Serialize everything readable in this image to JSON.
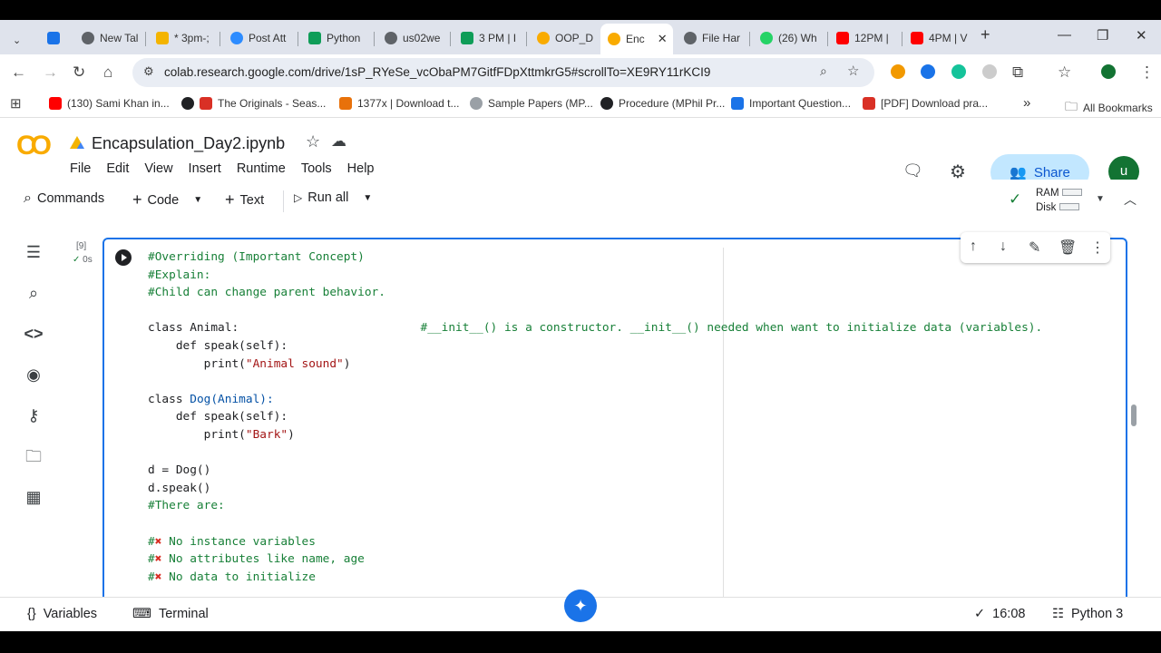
{
  "browser": {
    "tabs": [
      {
        "label": "New Tal",
        "color": "#5f6368"
      },
      {
        "label": "* 3pm-;",
        "color": "#f4b400"
      },
      {
        "label": "Post Att",
        "color": "#2d8cff"
      },
      {
        "label": "Python",
        "color": "#0f9d58"
      },
      {
        "label": "us02we",
        "color": "#5f6368"
      },
      {
        "label": "3 PM | I",
        "color": "#0f9d58"
      },
      {
        "label": "OOP_D",
        "color": "#f9ab00"
      },
      {
        "label": "Enc",
        "color": "#f9ab00"
      },
      {
        "label": "File Har",
        "color": "#5f6368"
      },
      {
        "label": "(26) Wh",
        "color": "#25d366"
      },
      {
        "label": "12PM |",
        "color": "#ff0000"
      },
      {
        "label": "4PM | V",
        "color": "#ff0000"
      }
    ],
    "url": "colab.research.google.com/drive/1sP_RYeSe_vcObaPM7GitfFDpXttmkrG5#scrollTo=XE9RY11rKCI9",
    "bookmarks": [
      "(130) Sami Khan in...",
      "The Originals - Seas...",
      "1377x | Download t...",
      "Sample Papers (MP...",
      "Procedure (MPhil Pr...",
      "Important Question...",
      "[PDF] Download pra..."
    ],
    "all_bookmarks": "All Bookmarks"
  },
  "colab": {
    "logo": "CO",
    "title": "Encapsulation_Day2.ipynb",
    "menu": [
      "File",
      "Edit",
      "View",
      "Insert",
      "Runtime",
      "Tools",
      "Help"
    ],
    "share": "Share",
    "avatar_letter": "u",
    "toolbar": {
      "commands": "Commands",
      "code": "Code",
      "text": "Text",
      "run_all": "Run all",
      "ram": "RAM",
      "disk": "Disk"
    },
    "cell": {
      "exec_count": "[9]",
      "exec_time": "0s",
      "lines": {
        "l1": "#Overriding (Important Concept)",
        "l2": "#Explain:",
        "l3": "#Child can change parent behavior.",
        "l5a": "class Animal:",
        "l5b": "#__init__() is a constructor. __init__() needed when want to initialize data (variables).",
        "l6": "    def speak(self):",
        "l7a": "        print(",
        "l7b": "\"Animal sound\"",
        "l7c": ")",
        "l9a": "class ",
        "l9b": "Dog(Animal):",
        "l10": "    def speak(self):",
        "l11a": "        print(",
        "l11b": "\"Bark\"",
        "l11c": ")",
        "l13": "d = Dog()",
        "l14": "d.speak()",
        "l15": "#There are:",
        "l17": "No instance variables",
        "l18": "No attributes like name, age",
        "l19": "No data to initialize"
      }
    },
    "status": {
      "variables": "Variables",
      "terminal": "Terminal",
      "time": "16:08",
      "kernel": "Python 3"
    }
  }
}
